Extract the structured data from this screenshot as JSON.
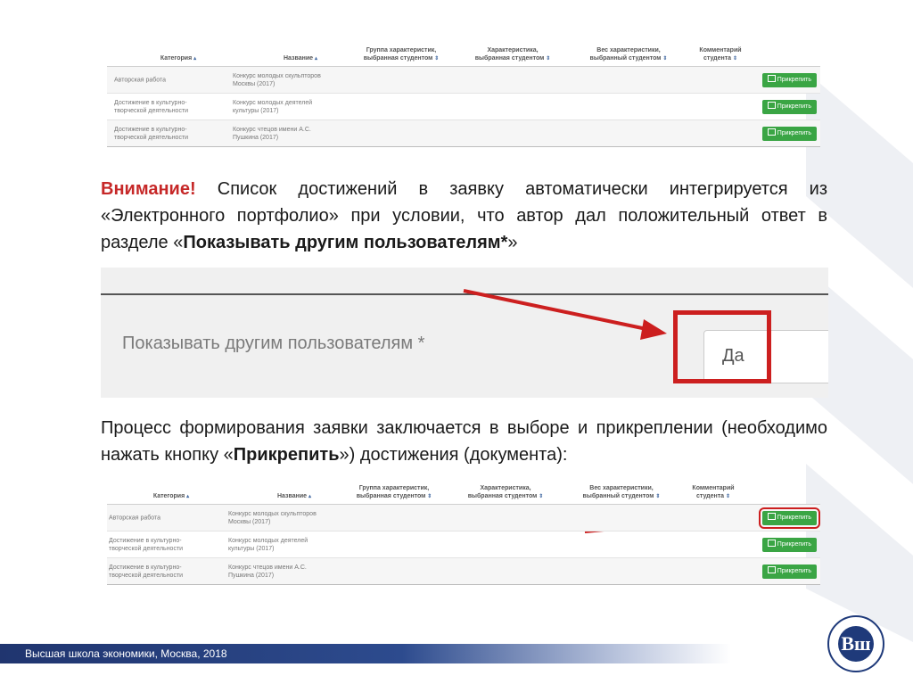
{
  "table": {
    "headers": {
      "category": "Категория",
      "name": "Название",
      "group_line1": "Группа характеристик,",
      "group_line2": "выбранная студентом",
      "char_line1": "Характеристика,",
      "char_line2": "выбранная студентом",
      "weight_line1": "Вес характеристики,",
      "weight_line2": "выбранный студентом",
      "comment_line1": "Комментарий",
      "comment_line2": "студента"
    },
    "sort_asc": "▴",
    "sort_both": "⇕",
    "rows": [
      {
        "cat1": "Авторская работа",
        "cat2": "",
        "name1": "Конкурс молодых скульпторов",
        "name2": "Москвы (2017)"
      },
      {
        "cat1": "Достижение в культурно-",
        "cat2": "творческой деятельности",
        "name1": "Конкурс молодых деятелей",
        "name2": "культуры (2017)"
      },
      {
        "cat1": "Достижение в культурно-",
        "cat2": "творческой деятельности",
        "name1": "Конкурс чтецов имени А.С.",
        "name2": "Пушкина (2017)"
      }
    ],
    "attach_label": "Прикрепить"
  },
  "notice": {
    "warning": "Внимание!",
    "text1": " Список достижений в заявку автоматически интегрируется из «Электронного портфолио» при условии, что автор дал положительный ответ в разделе «",
    "bold": "Показывать другим пользователям*",
    "text2": "»"
  },
  "form": {
    "label": "Показывать другим пользователям *",
    "value": "Да"
  },
  "process": {
    "text1": "Процесс формирования заявки заключается в выборе и прикреплении (необходимо нажать кнопку «",
    "bold": "Прикрепить",
    "text2": "») достижения (документа):"
  },
  "footer": {
    "text": "Высшая школа экономики, Москва, 2018"
  },
  "logo": {
    "monogram": "Вш",
    "icon": "hse-logo-icon"
  },
  "colors": {
    "accent_red": "#cc1f1f",
    "button_green": "#3aa544",
    "footer_blue": "#20356f"
  }
}
